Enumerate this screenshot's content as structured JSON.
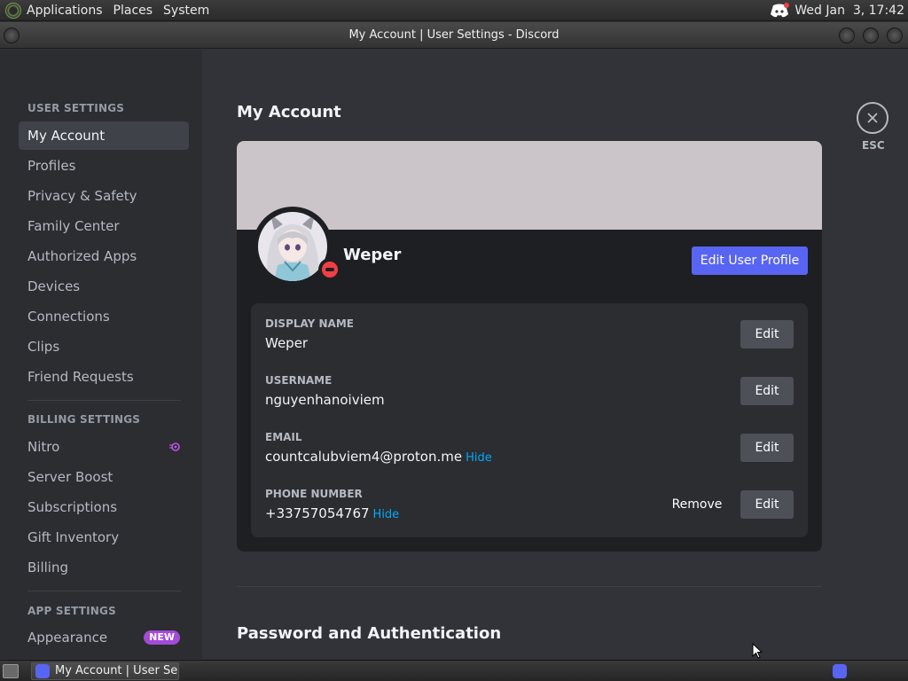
{
  "top_panel": {
    "menus": [
      "Applications",
      "Places",
      "System"
    ],
    "clock": "Wed Jan  3, 17:42"
  },
  "window": {
    "title": "My Account | User Settings - Discord"
  },
  "sidebar": {
    "user_settings_header": "USER SETTINGS",
    "user_items": [
      "My Account",
      "Profiles",
      "Privacy & Safety",
      "Family Center",
      "Authorized Apps",
      "Devices",
      "Connections",
      "Clips",
      "Friend Requests"
    ],
    "billing_header": "BILLING SETTINGS",
    "billing_items": [
      "Nitro",
      "Server Boost",
      "Subscriptions",
      "Gift Inventory",
      "Billing"
    ],
    "app_header": "APP SETTINGS",
    "app_items": [
      "Appearance"
    ],
    "new_badge": "NEW",
    "active_item": "My Account"
  },
  "main": {
    "title": "My Account",
    "profile_name": "Weper",
    "edit_profile_label": "Edit User Profile",
    "fields": [
      {
        "label": "DISPLAY NAME",
        "value": "Weper",
        "hide": ""
      },
      {
        "label": "USERNAME",
        "value": "nguyenhanoiviem",
        "hide": ""
      },
      {
        "label": "EMAIL",
        "value": "countcalubviem4@proton.me",
        "hide": "Hide"
      },
      {
        "label": "PHONE NUMBER",
        "value": "+33757054767",
        "hide": "Hide"
      }
    ],
    "edit_label": "Edit",
    "remove_label": "Remove",
    "password_section_title": "Password and Authentication",
    "esc_label": "ESC"
  },
  "taskbar": {
    "task_label": "My Account | User Se..."
  },
  "colors": {
    "accent": "#5865f2",
    "status_dnd": "#f23f43",
    "link": "#00a8fc",
    "new_badge": "#a34bd6"
  }
}
